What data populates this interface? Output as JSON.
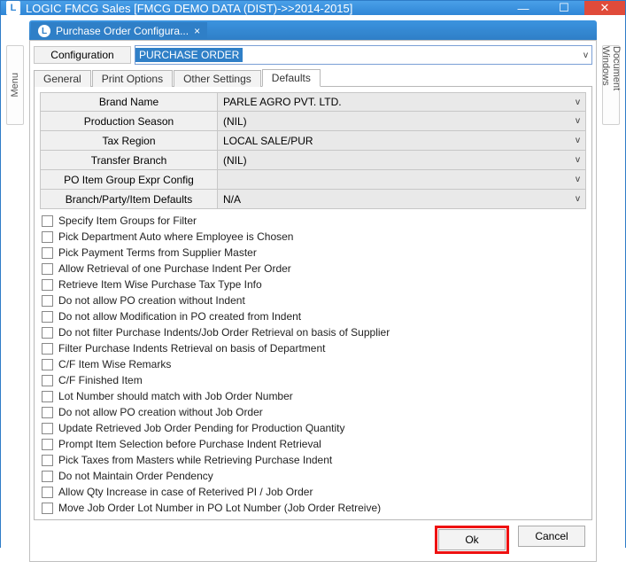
{
  "window": {
    "title": "LOGIC FMCG Sales  [FMCG DEMO DATA (DIST)->>2014-2015]",
    "app_icon_letter": "L"
  },
  "rails": {
    "left": "Menu",
    "right": "Document Windows"
  },
  "doc_tab": {
    "icon_letter": "L",
    "label": "Purchase Order Configura...",
    "close_glyph": "×"
  },
  "config": {
    "label": "Configuration",
    "value": "PURCHASE ORDER"
  },
  "tabs": {
    "items": [
      {
        "label": "General"
      },
      {
        "label": "Print Options"
      },
      {
        "label": "Other Settings"
      },
      {
        "label": "Defaults"
      }
    ],
    "active_index": 3
  },
  "fields": [
    {
      "label": "Brand Name",
      "value": "PARLE AGRO PVT. LTD."
    },
    {
      "label": "Production Season",
      "value": "(NIL)"
    },
    {
      "label": "Tax Region",
      "value": "LOCAL SALE/PUR"
    },
    {
      "label": "Transfer Branch",
      "value": "(NIL)"
    },
    {
      "label": "PO Item Group Expr Config",
      "value": ""
    },
    {
      "label": "Branch/Party/Item Defaults",
      "value": "N/A"
    }
  ],
  "checks": [
    "Specify Item Groups for Filter",
    "Pick Department Auto where Employee is Chosen",
    "Pick Payment Terms from Supplier Master",
    "Allow Retrieval of one Purchase Indent Per Order",
    "Retrieve Item Wise Purchase Tax Type Info",
    "Do not allow PO creation without Indent",
    "Do not allow Modification in PO created from Indent",
    "Do not filter Purchase Indents/Job Order Retrieval on basis of Supplier",
    "Filter Purchase Indents Retrieval on basis of Department",
    "C/F Item Wise Remarks",
    "C/F Finished Item",
    "Lot Number should match with Job Order Number",
    "Do not allow PO creation without Job Order",
    "Update Retrieved Job Order Pending for Production Quantity",
    "Prompt Item Selection before Purchase Indent Retrieval",
    "Pick Taxes from Masters while Retrieving Purchase Indent",
    "Do not Maintain Order Pendency",
    "Allow Qty Increase in case of Reterived PI / Job Order",
    "Move Job Order Lot Number in PO Lot Number (Job Order Retreive)"
  ],
  "buttons": {
    "ok": "Ok",
    "cancel": "Cancel"
  },
  "glyphs": {
    "minimize": "—",
    "maximize": "☐",
    "close": "✕",
    "chevron": "v"
  }
}
